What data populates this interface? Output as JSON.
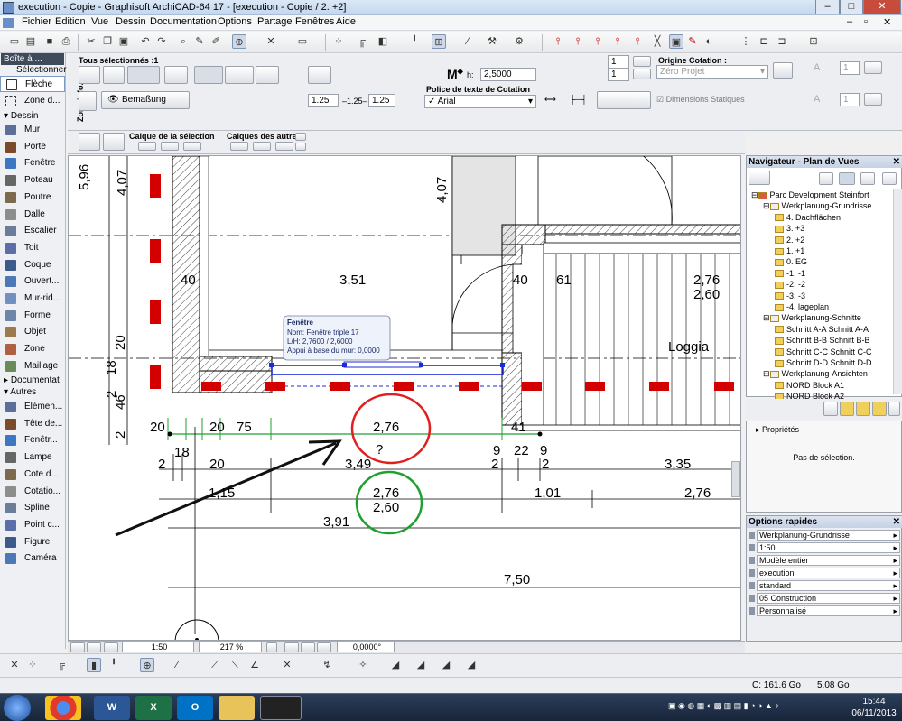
{
  "window": {
    "title": "execution - Copie - Graphisoft ArchiCAD-64 17 - [execution - Copie / 2. +2]",
    "controls": [
      "–",
      "□",
      "✕"
    ]
  },
  "menu": [
    "Fichier",
    "Edition",
    "Vue",
    "Dessin",
    "Documentation",
    "Options",
    "Partage",
    "Fenêtres",
    "Aide"
  ],
  "toolbox": {
    "title": "Boîte à ...",
    "select_label": "Sélectionner",
    "tools_top": [
      "Flèche",
      "Zone d..."
    ],
    "section_dessin": "Dessin",
    "tools_dessin": [
      "Mur",
      "Porte",
      "Fenêtre",
      "Poteau",
      "Poutre",
      "Dalle",
      "Escalier",
      "Toit",
      "Coque",
      "Ouvert...",
      "Mur-rid...",
      "Forme",
      "Objet",
      "Zone",
      "Maillage"
    ],
    "section_doc": "Documentat",
    "section_autres": "Autres",
    "tools_doc": [
      "Elémen...",
      "Tête de...",
      "Fenêtr...",
      "Lampe",
      "Cote d...",
      "Cotatio...",
      "Spline",
      "Point c...",
      "Figure",
      "Caméra"
    ]
  },
  "infobox": {
    "all_selected": "Tous sélectionnés :1",
    "vertical_label": "Zone info...",
    "bemassung": "Bemaßung",
    "h_label": "h:",
    "h_value": "2,5000",
    "pen1": "1",
    "pen2": "1",
    "origine_label": "Origine Cotation :",
    "origine_value": "Zéro Projet",
    "font_label": "Police de texte de Cotation",
    "font_value": "Arial",
    "dims_static": "Dimensions Statiques",
    "val_a": "1.25",
    "val_b": "1.25",
    "val_c": "1.25",
    "calque_sel": "Calque de la sélection",
    "calque_autres": "Calques des autres",
    "field_right": "1"
  },
  "drawing": {
    "dims_top": [
      "40",
      "3,51",
      "40",
      "61",
      "2,76",
      "2,60"
    ],
    "dim_596": "5,96",
    "dim_407_left": "4,07",
    "dim_407_right": "4,07",
    "sup5": "5",
    "loggia": "Loggia",
    "left_dims": [
      "20",
      "18",
      "2",
      "46",
      "2"
    ],
    "row1": [
      "20",
      "20",
      "75",
      "2,76",
      "41"
    ],
    "row1_sup": "5",
    "question": "?",
    "row2": [
      "2",
      "18",
      "20",
      "3,49",
      "2",
      "9",
      "22",
      "9",
      "2",
      "3,35"
    ],
    "row3": [
      "1,15",
      "2,76",
      "1,01",
      "2,76"
    ],
    "row3b": "2,60",
    "row4": "3,91",
    "row5": "7,50",
    "tooltip": {
      "title": "Fenêtre",
      "line1": "Nom: Fenêtre triple 17",
      "line2": "L/H: 2,7600 / 2,6000",
      "line3": "Appui à base du mur: 0,0000"
    }
  },
  "canvas_footer": {
    "scale": "1:50",
    "zoom": "217 %",
    "angle": "0,0000°"
  },
  "navigator": {
    "title": "Navigateur - Plan de Vues",
    "items": [
      {
        "level": 0,
        "label": "Parc Development Steinfort"
      },
      {
        "level": 1,
        "label": "Werkplanung-Grundrisse"
      },
      {
        "level": 2,
        "label": "4. Dachflächen"
      },
      {
        "level": 2,
        "label": "3. +3"
      },
      {
        "level": 2,
        "label": "2. +2"
      },
      {
        "level": 2,
        "label": "1. +1"
      },
      {
        "level": 2,
        "label": "0. EG"
      },
      {
        "level": 2,
        "label": "-1. -1"
      },
      {
        "level": 2,
        "label": "-2. -2"
      },
      {
        "level": 2,
        "label": "-3. -3"
      },
      {
        "level": 2,
        "label": "-4. lageplan"
      },
      {
        "level": 1,
        "label": "Werkplanung-Schnitte"
      },
      {
        "level": 2,
        "label": "Schnitt A-A Schnitt A-A"
      },
      {
        "level": 2,
        "label": "Schnitt B-B Schnitt B-B"
      },
      {
        "level": 2,
        "label": "Schnitt C-C Schnitt C-C"
      },
      {
        "level": 2,
        "label": "Schnitt D-D Schnitt D-D"
      },
      {
        "level": 1,
        "label": "Werkplanung-Ansichten"
      },
      {
        "level": 2,
        "label": "NORD Block A1"
      },
      {
        "level": 2,
        "label": "NORD Block A2"
      }
    ]
  },
  "properties": {
    "title": "Propriétés",
    "empty": "Pas de sélection."
  },
  "quick_options": {
    "title": "Options rapides",
    "rows": [
      "Werkplanung-Grundrisse",
      "1:50",
      "Modèle entier",
      "execution",
      "standard",
      "05 Construction",
      "Personnalisé"
    ]
  },
  "status": {
    "disk": "C: 161.6 Go",
    "mem": "5.08 Go"
  },
  "taskbar": {
    "time": "15:44",
    "date": "06/11/2013"
  },
  "colors": {
    "accent_red": "#d40000",
    "wall_hatch": "#444444",
    "selection_blue": "#1c2ad8",
    "annotation_red": "#e02020",
    "annotation_green": "#20a030"
  }
}
